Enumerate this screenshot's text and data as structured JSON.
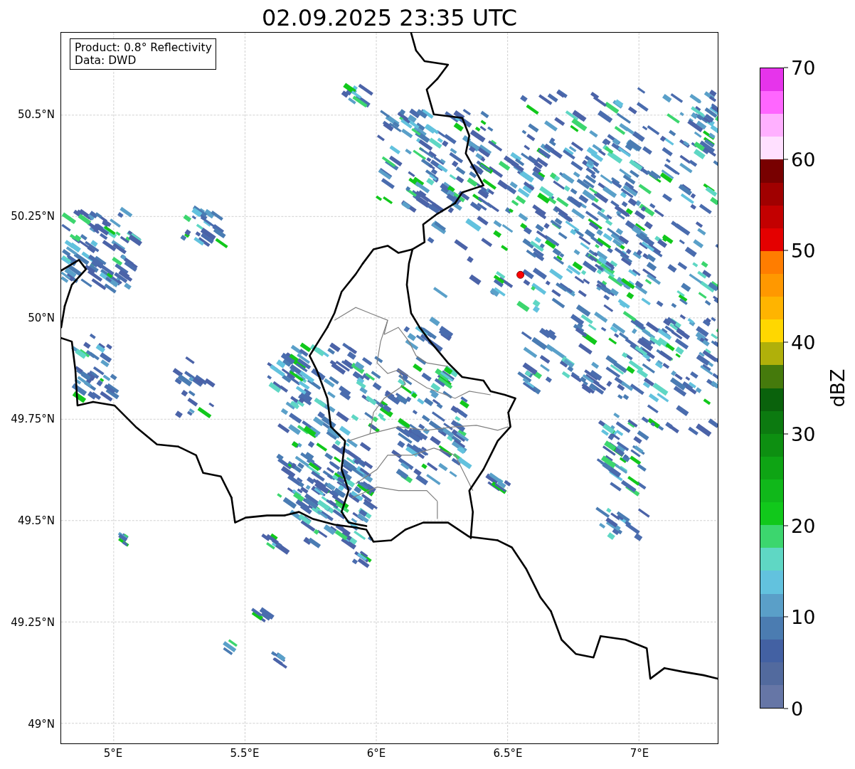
{
  "title": "02.09.2025 23:35 UTC",
  "map": {
    "annotation": [
      "Product: 0.8° Reflectivity",
      "Data: DWD"
    ],
    "yticks": [
      "50.5°N",
      "50.25°N",
      "50°N",
      "49.75°N",
      "49.5°N",
      "49.25°N",
      "49°N"
    ],
    "xticks": [
      "5°E",
      "5.5°E",
      "6°E",
      "6.5°E",
      "7°E"
    ]
  },
  "colorbar": {
    "label": "dBZ",
    "ticks": [
      "70",
      "60",
      "50",
      "40",
      "30",
      "20",
      "10",
      "0"
    ],
    "segments": [
      {
        "color": "#e634eb"
      },
      {
        "color": "#ff66ff"
      },
      {
        "color": "#ffb0ff"
      },
      {
        "color": "#ffe0ff"
      },
      {
        "color": "#780000"
      },
      {
        "color": "#a00000"
      },
      {
        "color": "#c30000"
      },
      {
        "color": "#e40000"
      },
      {
        "color": "#ff7d00"
      },
      {
        "color": "#ff9800"
      },
      {
        "color": "#ffb400"
      },
      {
        "color": "#ffd700"
      },
      {
        "color": "#b0b00a"
      },
      {
        "color": "#457a0c"
      },
      {
        "color": "#0a620c"
      },
      {
        "color": "#0c7a10"
      },
      {
        "color": "#0d8f11"
      },
      {
        "color": "#0ea414"
      },
      {
        "color": "#10b81a"
      },
      {
        "color": "#11c81b"
      },
      {
        "color": "#3cd66e"
      },
      {
        "color": "#5fd7c4"
      },
      {
        "color": "#62c2de"
      },
      {
        "color": "#5a9fc8"
      },
      {
        "color": "#4b7cb1"
      },
      {
        "color": "#4361a3"
      },
      {
        "color": "#526a9e"
      },
      {
        "color": "#6676a6"
      }
    ]
  }
}
